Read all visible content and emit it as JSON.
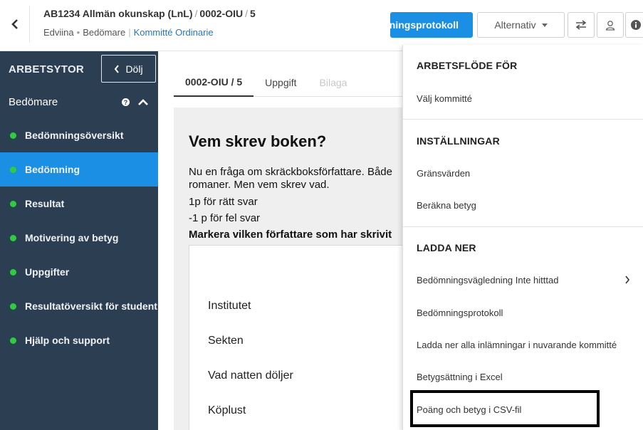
{
  "header": {
    "course": "AB1234 Allmän okunskap (LnL)",
    "exam": "0002-OIU",
    "number": "5",
    "org": "Edviina",
    "role": "Bedömare",
    "committee": "Kommitté Ordinarie",
    "primary_button": "Bedömningsprotokoll",
    "alternatives_button": "Alternativ"
  },
  "sidebar": {
    "title": "ARBETSYTOR",
    "hide_button": "Dölj",
    "role_title": "Bedömare",
    "help": "?",
    "items": [
      {
        "label": "Bedömningsöversikt"
      },
      {
        "label": "Bedömning"
      },
      {
        "label": "Resultat"
      },
      {
        "label": "Motivering av betyg"
      },
      {
        "label": "Uppgifter"
      },
      {
        "label": "Resultatöversikt för student"
      },
      {
        "label": "Hjälp och support"
      }
    ]
  },
  "tabs": [
    "0002-OIU / 5",
    "Uppgift",
    "Bilaga"
  ],
  "question": {
    "title": "Vem skrev boken?",
    "text_line1": "Nu en fråga om skräckboksförfattare. Både",
    "text_line2": "romaner. Men vem skrev vad.",
    "points_right": "1p för rätt svar",
    "points_wrong": "-1 p för fel svar",
    "instruction": "Markera vilken författare som har skrivit",
    "options": [
      "Institutet",
      "Sekten",
      "Vad natten döljer",
      "Köplust"
    ]
  },
  "menu": {
    "section1_title": "ARBETSFLÖDE FÖR",
    "choose_committee": "Välj kommitté",
    "section2_title": "INSTÄLLNINGAR",
    "thresholds": "Gränsvärden",
    "calculate_grades": "Beräkna betyg",
    "section3_title": "LADDA NER",
    "guide": "Bedömningsvägledning Inte hitttad",
    "protocol": "Bedömningsprotokoll",
    "download_all": "Ladda ner alla inlämningar i nuvarande kommitté",
    "grading_excel": "Betygsättning i Excel",
    "csv": "Poäng och betyg i CSV-fil"
  }
}
